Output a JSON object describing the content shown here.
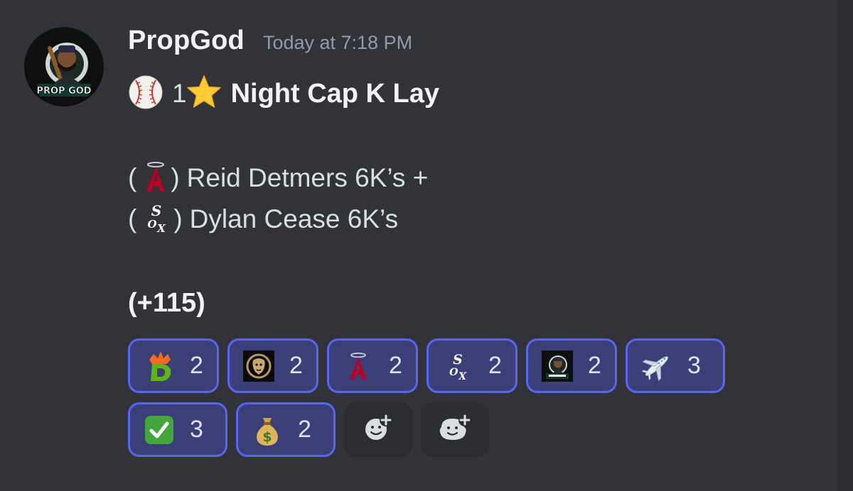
{
  "message": {
    "username": "PropGod",
    "timestamp": "Today at 7:18 PM",
    "avatar": {
      "icon": "prop-god-avatar",
      "text": "PROP GOD"
    },
    "title": {
      "emoji": "baseball",
      "prefix": "1",
      "star_emoji": "star",
      "text": "Night Cap K Lay"
    },
    "picks": [
      {
        "open": "(",
        "icon": "angels-logo",
        "close": ")",
        "text": "Reid Detmers 6K’s +"
      },
      {
        "open": "(",
        "icon": "white-sox-logo",
        "close": ")",
        "text": "Dylan Cease 6K’s"
      }
    ],
    "odds": "(+115)"
  },
  "reactions": [
    {
      "icon": "draftkings-logo",
      "count": "2"
    },
    {
      "icon": "betmgm-lion-logo",
      "count": "2"
    },
    {
      "icon": "angels-logo",
      "count": "2"
    },
    {
      "icon": "white-sox-logo",
      "count": "2"
    },
    {
      "icon": "prop-god-avatar",
      "count": "2"
    },
    {
      "icon": "airplane-emoji",
      "count": "3"
    },
    {
      "icon": "check-mark-emoji",
      "count": "3"
    },
    {
      "icon": "money-bag-emoji",
      "count": "2"
    }
  ],
  "actions": [
    {
      "icon": "add-reaction-icon"
    },
    {
      "icon": "add-super-reaction-icon"
    }
  ],
  "colors": {
    "background": "#313338",
    "reaction_bg": "#3b3f78",
    "reaction_border": "#5865f2",
    "timestamp": "#949ba4",
    "text": "#dbdee1"
  }
}
